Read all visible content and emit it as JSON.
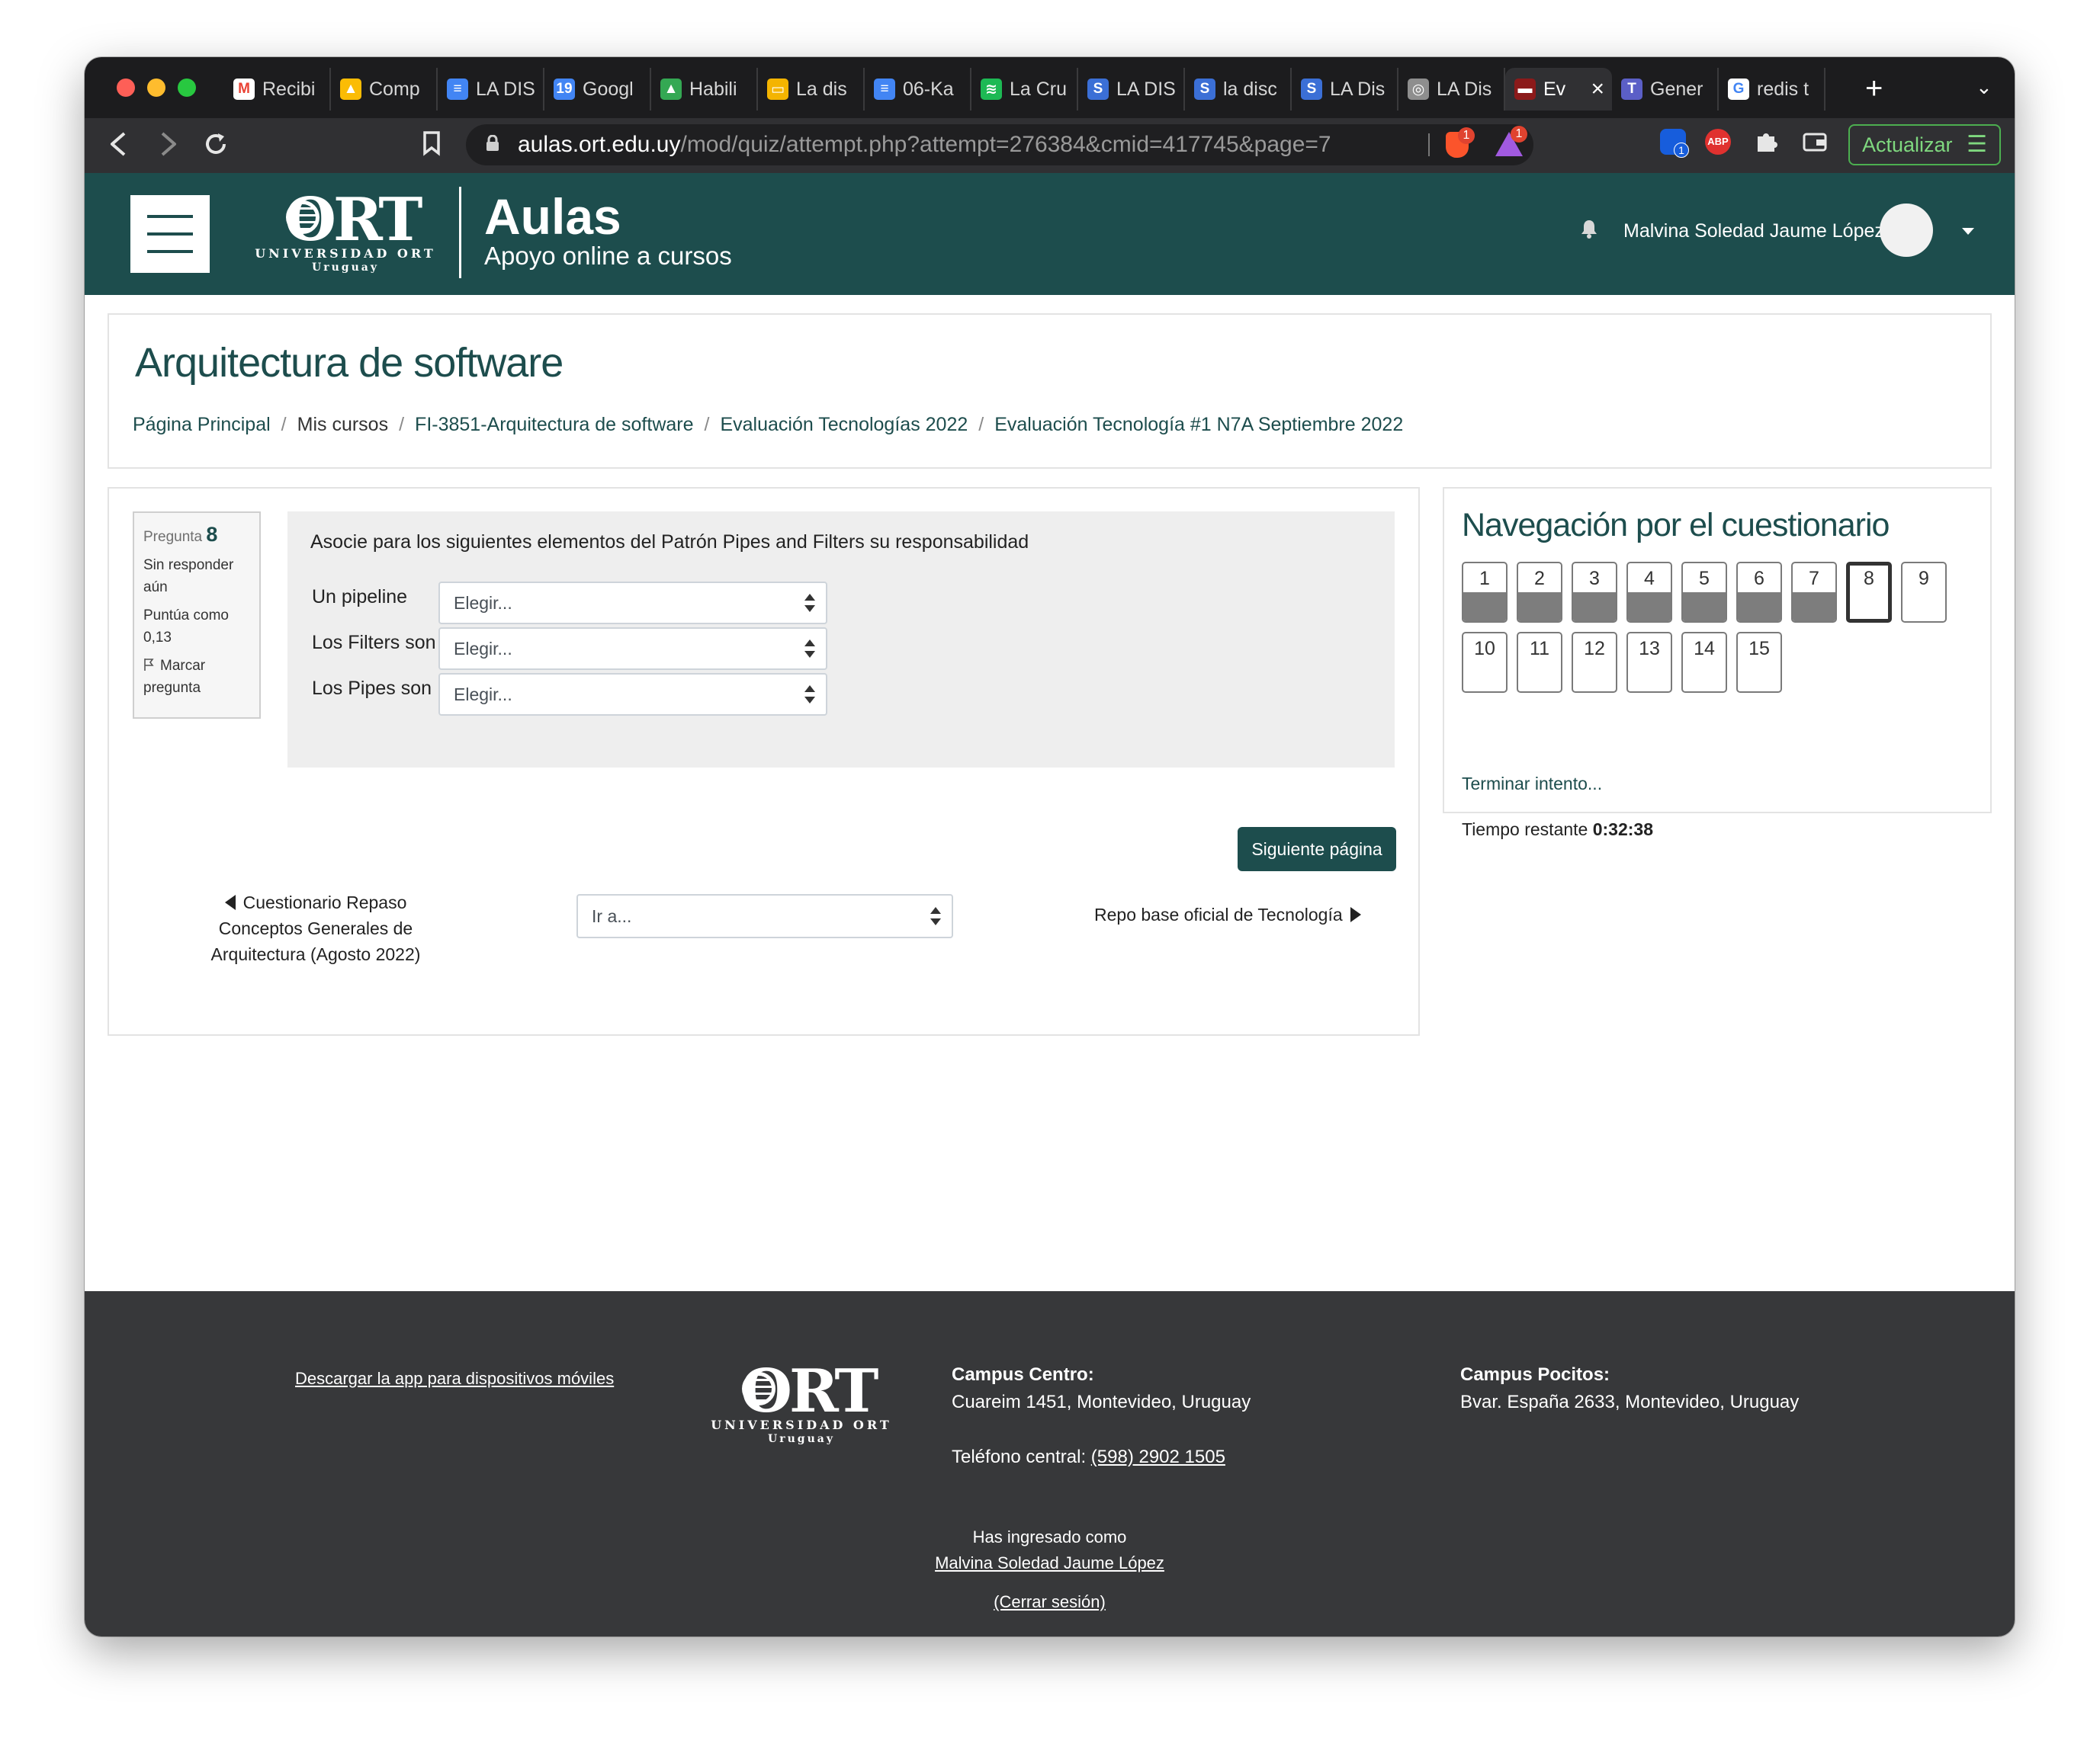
{
  "browser": {
    "tabs": [
      {
        "label": "Recibi",
        "icon": "gmail-icon",
        "color": "#ea4335",
        "glyph": "M"
      },
      {
        "label": "Comp",
        "icon": "drive-icon",
        "color": "#fbbc04",
        "glyph": "▲"
      },
      {
        "label": "LA DIS",
        "icon": "docs-icon",
        "color": "#4285f4",
        "glyph": "≡"
      },
      {
        "label": "Googl",
        "icon": "calendar-icon",
        "color": "#4285f4",
        "glyph": "19"
      },
      {
        "label": "Habili",
        "icon": "drive-icon",
        "color": "#34a853",
        "glyph": "▲"
      },
      {
        "label": "La dis",
        "icon": "slides-icon",
        "color": "#f4b400",
        "glyph": "▭"
      },
      {
        "label": "06-Ka",
        "icon": "docs-icon",
        "color": "#4285f4",
        "glyph": "≡"
      },
      {
        "label": "La Cru",
        "icon": "spotify-icon",
        "color": "#1db954",
        "glyph": "≋"
      },
      {
        "label": "LA DIS",
        "icon": "s-icon",
        "color": "#3b6fd6",
        "glyph": "S"
      },
      {
        "label": "la disc",
        "icon": "s-icon",
        "color": "#3b6fd6",
        "glyph": "S"
      },
      {
        "label": "LA Dis",
        "icon": "s-icon",
        "color": "#3b6fd6",
        "glyph": "S"
      },
      {
        "label": "LA Dis",
        "icon": "globe-icon",
        "color": "#8e8e8e",
        "glyph": "◎"
      },
      {
        "label": "Ev",
        "icon": "ort-icon",
        "color": "#8b1a1a",
        "glyph": "▬",
        "active": true
      },
      {
        "label": "Gener",
        "icon": "teams-icon",
        "color": "#5b5fc7",
        "glyph": "T"
      },
      {
        "label": "redis t",
        "icon": "google-icon",
        "color": "#ffffff",
        "glyph": "G"
      }
    ],
    "new_tab": "+",
    "tab_menu": "⌄",
    "url_domain": "aulas.ort.edu.uy",
    "url_path": "/mod/quiz/attempt.php?attempt=276384&cmid=417745&page=7",
    "brave_badge": "1",
    "rewards_badge": "1",
    "bitwarden_badge": "1",
    "abp_label": "ABP",
    "update_label": "Actualizar"
  },
  "header": {
    "logo_text": "ORT",
    "logo_university": "UNIVERSIDAD ORT",
    "logo_country": "Uruguay",
    "title": "Aulas",
    "subtitle": "Apoyo online a cursos",
    "username": "Malvina Soledad Jaume López"
  },
  "page": {
    "title": "Arquitectura de software",
    "breadcrumb": [
      "Página Principal",
      "Mis cursos",
      "FI-3851-Arquitectura de software",
      "Evaluación Tecnologías 2022",
      "Evaluación Tecnología #1 N7A Septiembre 2022"
    ]
  },
  "question": {
    "label": "Pregunta",
    "number": "8",
    "status": "Sin responder aún",
    "score": "Puntúa como 0,13",
    "flag_label": "Marcar pregunta",
    "text": "Asocie para los siguientes elementos del Patrón Pipes and Filters su responsabilidad",
    "items": [
      {
        "label": "Un pipeline",
        "value": "Elegir..."
      },
      {
        "label": "Los Filters son",
        "value": "Elegir..."
      },
      {
        "label": "Los Pipes son",
        "value": "Elegir..."
      }
    ],
    "next_button": "Siguiente página"
  },
  "activity_nav": {
    "prev": "Cuestionario Repaso Conceptos Generales de Arquitectura (Agosto 2022)",
    "jump_placeholder": "Ir a...",
    "next": "Repo base oficial de Tecnología"
  },
  "quiz_nav": {
    "title": "Navegación por el cuestionario",
    "questions": [
      {
        "n": "1",
        "state": "answered"
      },
      {
        "n": "2",
        "state": "answered"
      },
      {
        "n": "3",
        "state": "answered"
      },
      {
        "n": "4",
        "state": "answered"
      },
      {
        "n": "5",
        "state": "answered"
      },
      {
        "n": "6",
        "state": "answered"
      },
      {
        "n": "7",
        "state": "answered"
      },
      {
        "n": "8",
        "state": "current"
      },
      {
        "n": "9",
        "state": "empty"
      },
      {
        "n": "10",
        "state": "empty"
      },
      {
        "n": "11",
        "state": "empty"
      },
      {
        "n": "12",
        "state": "empty"
      },
      {
        "n": "13",
        "state": "empty"
      },
      {
        "n": "14",
        "state": "empty"
      },
      {
        "n": "15",
        "state": "empty"
      }
    ],
    "finish_link": "Terminar intento...",
    "time_label": "Tiempo restante",
    "time_value": "0:32:38"
  },
  "footer": {
    "app_link": "Descargar la app para dispositivos móviles",
    "campus_centro_title": "Campus Centro:",
    "campus_centro_address": "Cuareim 1451, Montevideo, Uruguay",
    "phone_label": "Teléfono central:",
    "phone": "(598) 2902 1505",
    "campus_pocitos_title": "Campus Pocitos:",
    "campus_pocitos_address": "Bvar. España 2633, Montevideo, Uruguay",
    "logged_in_as": "Has ingresado como",
    "logged_user": "Malvina Soledad Jaume López",
    "logout": "(Cerrar sesión)"
  },
  "colors": {
    "brand": "#1d4d4d",
    "footer_bg": "#37383a"
  }
}
